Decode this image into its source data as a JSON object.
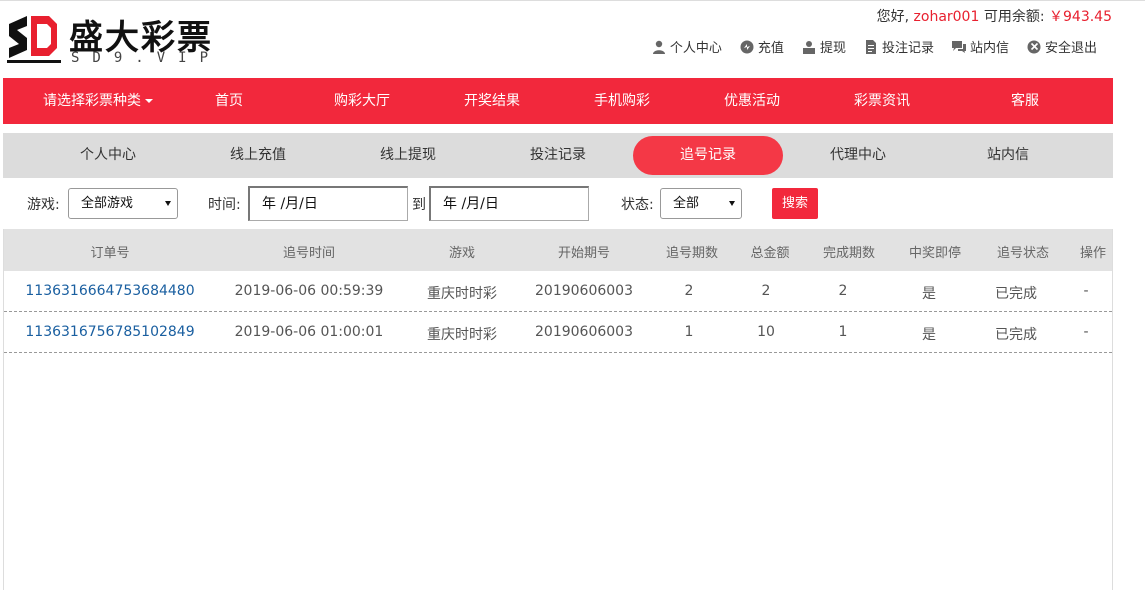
{
  "brand": {
    "title": "盛大彩票",
    "subtitle": "SD9.VIP",
    "accent": "#f2283c"
  },
  "user": {
    "greeting": "您好,",
    "username": "zohar001",
    "balance_label": "可用余额:",
    "balance": "￥943.45"
  },
  "toplinks": [
    {
      "icon": "user-icon",
      "label": "个人中心"
    },
    {
      "icon": "recharge-icon",
      "label": "充值"
    },
    {
      "icon": "withdraw-icon",
      "label": "提现"
    },
    {
      "icon": "bet-record-icon",
      "label": "投注记录"
    },
    {
      "icon": "message-icon",
      "label": "站内信"
    },
    {
      "icon": "logout-icon",
      "label": "安全退出"
    }
  ],
  "mainnav": [
    "请选择彩票种类",
    "首页",
    "购彩大厅",
    "开奖结果",
    "手机购彩",
    "优惠活动",
    "彩票资讯",
    "客服"
  ],
  "subnav": {
    "tabs": [
      "个人中心",
      "线上充值",
      "线上提现",
      "投注记录",
      "追号记录",
      "代理中心",
      "站内信"
    ],
    "active": "追号记录"
  },
  "filters": {
    "game_label": "游戏:",
    "game_value": "全部游戏",
    "time_label": "时间:",
    "date_from": "年 /月/日",
    "to_label": "到",
    "date_to": "年 /月/日",
    "status_label": "状态:",
    "status_value": "全部",
    "search_label": "搜索"
  },
  "table": {
    "columns": [
      "订单号",
      "追号时间",
      "游戏",
      "开始期号",
      "追号期数",
      "总金额",
      "完成期数",
      "中奖即停",
      "追号状态",
      "操作"
    ],
    "rows": [
      [
        "1136316664753684480",
        "2019-06-06 00:59:39",
        "重庆时时彩",
        "20190606003",
        "2",
        "2",
        "2",
        "是",
        "已完成",
        "-"
      ],
      [
        "1136316756785102849",
        "2019-06-06 01:00:01",
        "重庆时时彩",
        "20190606003",
        "1",
        "10",
        "1",
        "是",
        "已完成",
        "-"
      ]
    ]
  }
}
